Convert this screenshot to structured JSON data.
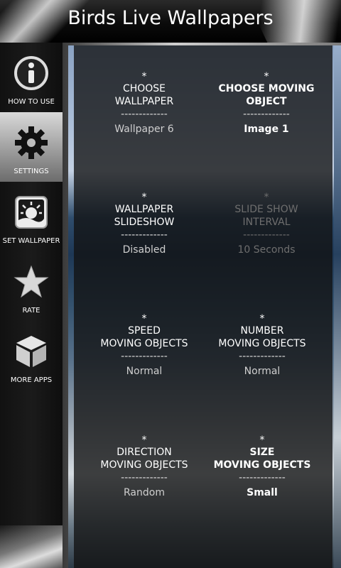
{
  "header": {
    "title": "Birds Live Wallpapers"
  },
  "sidebar": {
    "items": [
      {
        "label": "HOW TO USE",
        "icon": "info-icon"
      },
      {
        "label": "SETTINGS",
        "icon": "gear-icon"
      },
      {
        "label": "SET WALLPAPER",
        "icon": "sun-landscape-icon"
      },
      {
        "label": "RATE",
        "icon": "star-icon"
      },
      {
        "label": "MORE APPS",
        "icon": "cube-icon"
      }
    ]
  },
  "settings": [
    {
      "star": "*",
      "name": "CHOOSE\nWALLPAPER",
      "dash": "-------------",
      "value": "Wallpaper 6"
    },
    {
      "star": "*",
      "name": "CHOOSE MOVING\nOBJECT",
      "dash": "-------------",
      "value": "Image 1"
    },
    {
      "star": "*",
      "name": "WALLPAPER\nSLIDESHOW",
      "dash": "-------------",
      "value": "Disabled"
    },
    {
      "star": "*",
      "name": "SLIDE SHOW\nINTERVAL",
      "dash": "-------------",
      "value": "10 Seconds"
    },
    {
      "star": "*",
      "name": "SPEED\nMOVING OBJECTS",
      "dash": "-------------",
      "value": "Normal"
    },
    {
      "star": "*",
      "name": "NUMBER\nMOVING OBJECTS",
      "dash": "-------------",
      "value": "Normal"
    },
    {
      "star": "*",
      "name": "DIRECTION\nMOVING OBJECTS",
      "dash": "-------------",
      "value": "Random"
    },
    {
      "star": "*",
      "name": "SIZE\nMOVING OBJECTS",
      "dash": "-------------",
      "value": "Small"
    }
  ]
}
